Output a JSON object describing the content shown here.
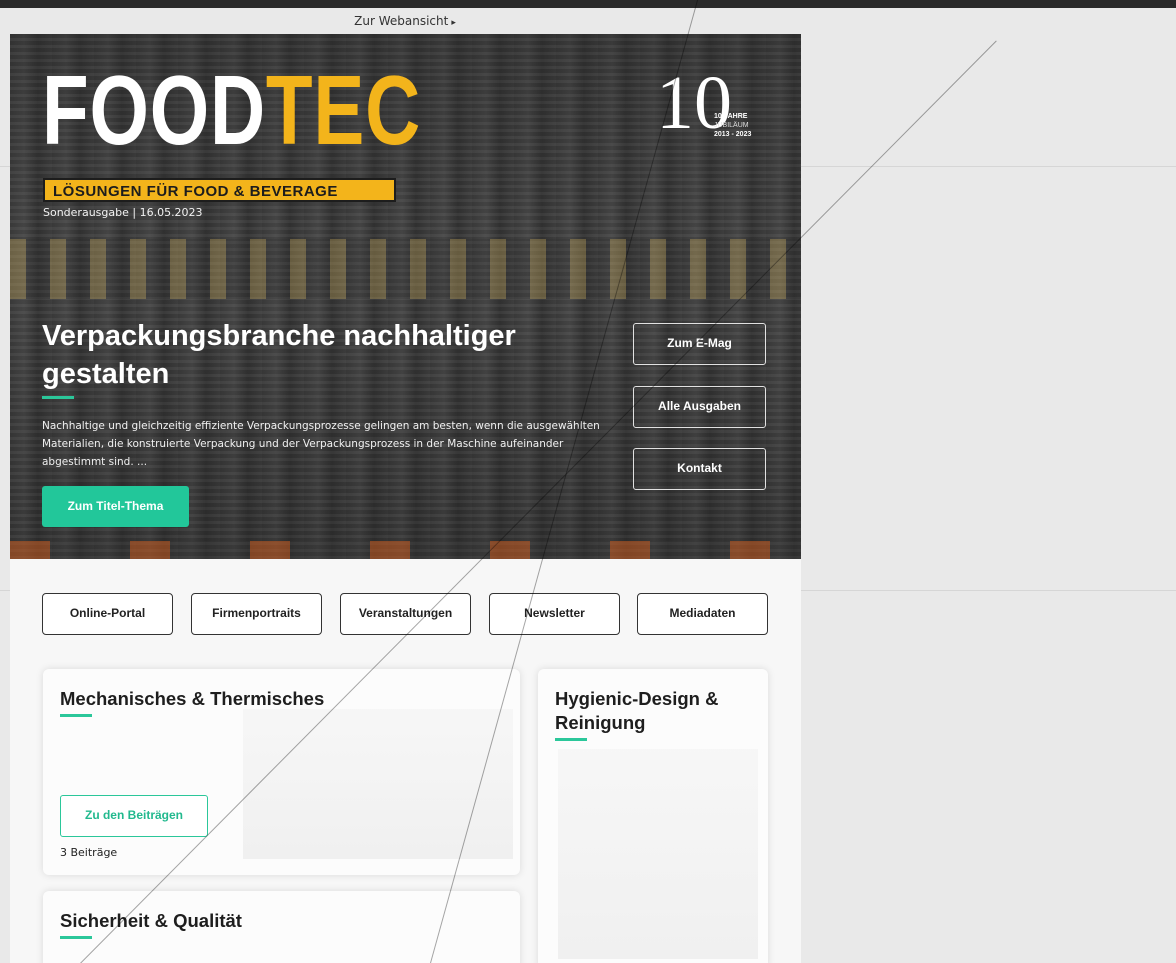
{
  "webview": {
    "label": "Zur Webansicht",
    "arrow": "▸"
  },
  "hero": {
    "logo_food": "FOOD",
    "logo_tec": "TEC",
    "tagline": "LÖSUNGEN FÜR FOOD & BEVERAGE",
    "edition": "Sonderausgabe | 16.05.2023",
    "jubilee_number": "10",
    "jubilee_line1": "10 JAHRE",
    "jubilee_line2": "JUBILÄUM",
    "jubilee_line3": "2013 - 2023",
    "title": "Verpackungsbranche nachhaltiger gestalten",
    "teaser": "Nachhaltige und gleichzeitig effiziente Verpackungsprozesse gelingen am besten, wenn die ausgewählten Materialien, die konstruierte Verpackung und der Verpackungsprozess in der Maschine aufeinander abgestimmt sind. ...",
    "cta": "Zum Titel-Thema",
    "side_buttons": [
      "Zum E-Mag",
      "Alle Ausgaben",
      "Kontakt"
    ]
  },
  "nav": [
    "Online-Portal",
    "Firmenportraits",
    "Veranstaltungen",
    "Newsletter",
    "Mediadaten"
  ],
  "cards": {
    "mech": {
      "title": "Mechanisches & Thermisches",
      "button": "Zu den Beiträgen",
      "count": "3 Beiträge"
    },
    "hygienic": {
      "title": "Hygienic-Design & Reinigung"
    },
    "safety": {
      "title": "Sicherheit & Qualität"
    }
  },
  "colors": {
    "accent": "#2bc79a",
    "brand_yellow": "#f3b41b",
    "dark": "#1e1e1e"
  }
}
